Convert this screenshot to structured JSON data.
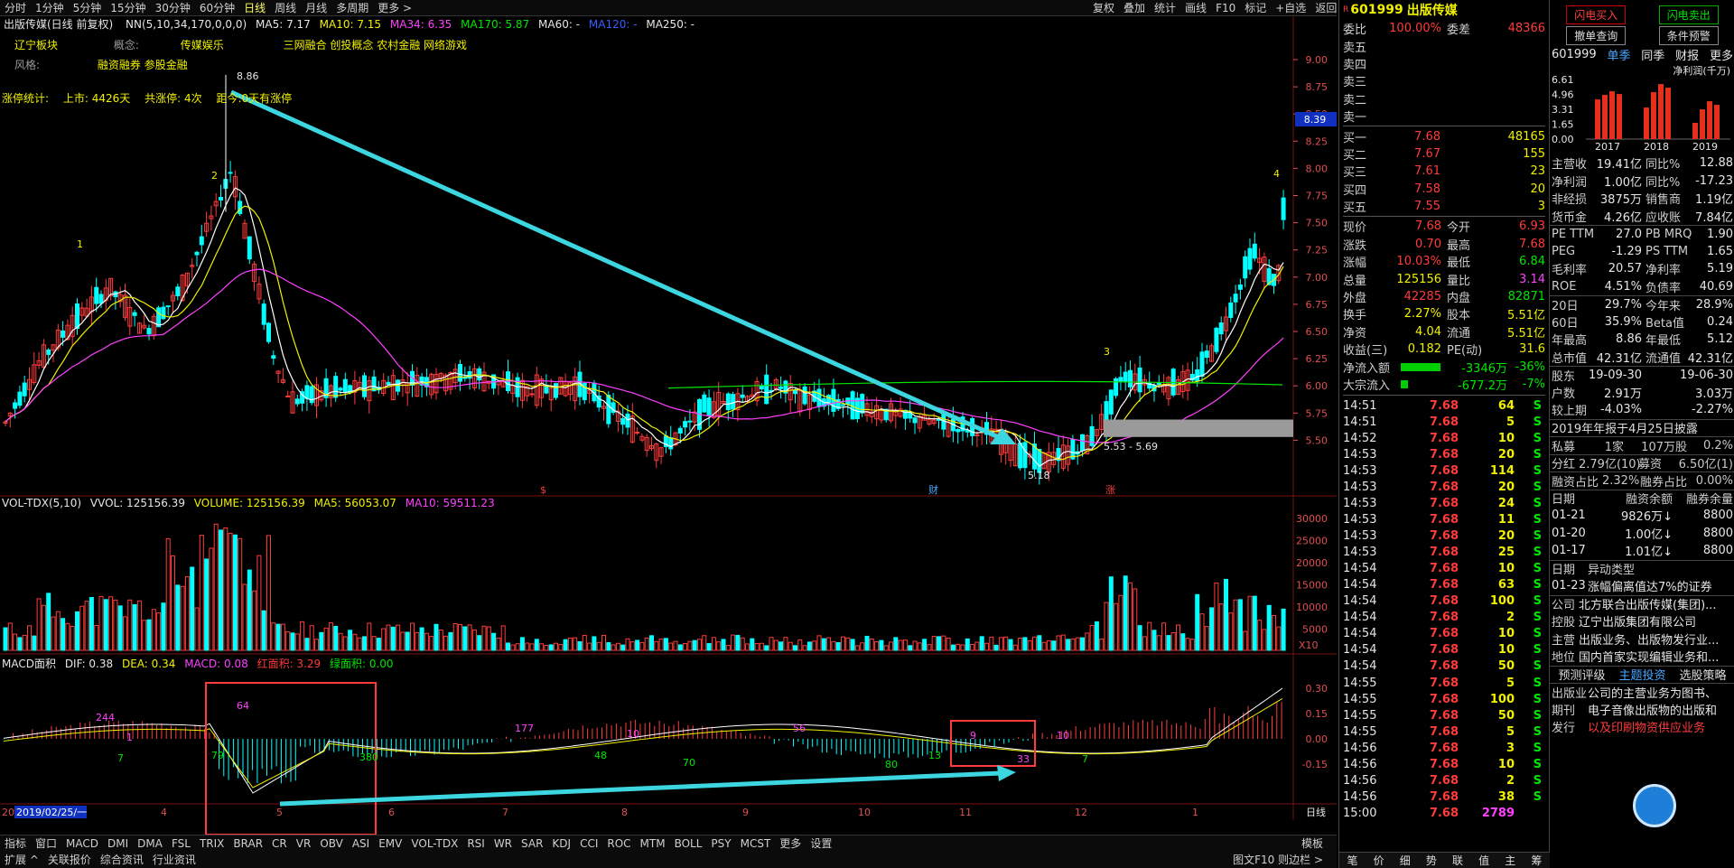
{
  "topbar": {
    "periods": [
      "分时",
      "1分钟",
      "5分钟",
      "15分钟",
      "30分钟",
      "60分钟",
      "日线",
      "周线",
      "月线",
      "多周期",
      "更多 >"
    ],
    "active": "日线",
    "right_tools": [
      "复权",
      "叠加",
      "统计",
      "画线",
      "F10",
      "标记",
      "+自选",
      "返回"
    ]
  },
  "main": {
    "title": "出版传媒(日线 前复权)",
    "ma": {
      "nn": "NN(5,10,34,170,0,0,0)",
      "ma5": "MA5: 7.17",
      "ma10": "MA10: 7.15",
      "ma34": "MA34: 6.35",
      "ma170": "MA170: 5.87",
      "ma60": "MA60: -",
      "ma120": "MA120: -",
      "ma250": "MA250: -"
    },
    "sector": {
      "label": "辽宁板块",
      "concept_label": "概念:",
      "concept_value": "传媒娱乐",
      "concepts": "三网融合 创投概念 农村金融 网络游戏"
    },
    "style": {
      "label": "风格:",
      "value": "融资融券 参股金融"
    },
    "stats": {
      "label": "涨停统计:",
      "listed": "上市: 4426天",
      "total": "共涨停: 4次",
      "since": "距今:0天有涨停"
    },
    "annotations": {
      "high": "8.86",
      "low": "5.18",
      "range": "5.53 - 5.69",
      "n1": "1",
      "n2": "2",
      "n3": "3",
      "n4": "4",
      "price_tag": "8.39"
    },
    "events": [
      "$",
      "财",
      "涨"
    ],
    "price_axis": [
      "9.00",
      "8.75",
      "8.50",
      "8.25",
      "8.00",
      "7.75",
      "7.50",
      "7.25",
      "7.00",
      "6.75",
      "6.50",
      "6.25",
      "6.00",
      "5.75",
      "5.50"
    ],
    "vol": {
      "title": "VOL-TDX(5,10)",
      "vvol": "VVOL: 125156.39",
      "volume": "VOLUME: 125156.39",
      "ma5": "MA5: 56053.07",
      "ma10": "MA10: 59511.23",
      "axis": [
        "30000",
        "25000",
        "20000",
        "15000",
        "10000",
        "5000"
      ],
      "unit": "X10"
    },
    "macd": {
      "title": "MACD面积",
      "dif": "DIF: 0.38",
      "dea": "DEA: 0.34",
      "macd": "MACD: 0.08",
      "red_area": "红面积: 3.29",
      "green_area": "绿面积: 0.00",
      "axis": [
        "0.30",
        "0.15",
        "0.00",
        "-0.15"
      ],
      "labels": [
        "244",
        "1",
        "7",
        "64",
        "79",
        "380",
        "177",
        "48",
        "10",
        "70",
        "56",
        "80",
        "13",
        "9",
        "33",
        "10",
        "7"
      ]
    },
    "time_axis": {
      "current": "2019/02/25/一",
      "months": [
        "4",
        "5",
        "6",
        "7",
        "8",
        "9",
        "10",
        "11",
        "12",
        "1"
      ],
      "label": "日线",
      "start": "20"
    }
  },
  "bottombar": {
    "row1": [
      "指标",
      "窗口",
      "MACD",
      "DMI",
      "DMA",
      "FSL",
      "TRIX",
      "BRAR",
      "CR",
      "VR",
      "OBV",
      "ASI",
      "EMV",
      "VOL-TDX",
      "RSI",
      "WR",
      "SAR",
      "KDJ",
      "CCI",
      "ROC",
      "MTM",
      "BOLL",
      "PSY",
      "MCST",
      "更多",
      "设置"
    ],
    "row1_right": "模板",
    "row2": [
      "扩展 ^",
      "关联报价",
      "综合资讯",
      "行业资讯"
    ],
    "row2_right": "图文F10 则边栏 >"
  },
  "quote": {
    "code": "601999",
    "name": "出版传媒",
    "r": "R",
    "weibi": {
      "k": "委比",
      "v": "100.00%",
      "k2": "委差",
      "v2": "48366"
    },
    "sells": [
      {
        "k": "卖五"
      },
      {
        "k": "卖四"
      },
      {
        "k": "卖三"
      },
      {
        "k": "卖二"
      },
      {
        "k": "卖一"
      }
    ],
    "buys": [
      {
        "k": "买一",
        "p": "7.68",
        "q": "48165"
      },
      {
        "k": "买二",
        "p": "7.67",
        "q": "155"
      },
      {
        "k": "买三",
        "p": "7.61",
        "q": "23"
      },
      {
        "k": "买四",
        "p": "7.58",
        "q": "20"
      },
      {
        "k": "买五",
        "p": "7.55",
        "q": "3"
      }
    ],
    "stats": [
      {
        "k": "现价",
        "v": "7.68",
        "k2": "今开",
        "v2": "6.93"
      },
      {
        "k": "涨跌",
        "v": "0.70",
        "k2": "最高",
        "v2": "7.68"
      },
      {
        "k": "涨幅",
        "v": "10.03%",
        "k2": "最低",
        "v2": "6.84"
      },
      {
        "k": "总量",
        "v": "125156",
        "k2": "量比",
        "v2": "3.14"
      },
      {
        "k": "外盘",
        "v": "42285",
        "k2": "内盘",
        "v2": "82871"
      },
      {
        "k": "换手",
        "v": "2.27%",
        "k2": "股本",
        "v2": "5.51亿"
      },
      {
        "k": "净资",
        "v": "4.04",
        "k2": "流通",
        "v2": "5.51亿"
      },
      {
        "k": "收益(三)",
        "v": "0.182",
        "k2": "PE(动)",
        "v2": "31.6"
      }
    ],
    "flow": [
      {
        "k": "净流入额",
        "v": "-3346万",
        "p": "-36%"
      },
      {
        "k": "大宗流入",
        "v": "-677.2万",
        "p": "-7%"
      }
    ],
    "trades": [
      {
        "t": "14:51",
        "p": "7.68",
        "q": "64",
        "s": "S"
      },
      {
        "t": "14:51",
        "p": "7.68",
        "q": "5",
        "s": "S"
      },
      {
        "t": "14:52",
        "p": "7.68",
        "q": "10",
        "s": "S"
      },
      {
        "t": "14:53",
        "p": "7.68",
        "q": "20",
        "s": "S"
      },
      {
        "t": "14:53",
        "p": "7.68",
        "q": "114",
        "s": "S"
      },
      {
        "t": "14:53",
        "p": "7.68",
        "q": "20",
        "s": "S"
      },
      {
        "t": "14:53",
        "p": "7.68",
        "q": "24",
        "s": "S"
      },
      {
        "t": "14:53",
        "p": "7.68",
        "q": "11",
        "s": "S"
      },
      {
        "t": "14:53",
        "p": "7.68",
        "q": "20",
        "s": "S"
      },
      {
        "t": "14:53",
        "p": "7.68",
        "q": "25",
        "s": "S"
      },
      {
        "t": "14:54",
        "p": "7.68",
        "q": "10",
        "s": "S"
      },
      {
        "t": "14:54",
        "p": "7.68",
        "q": "63",
        "s": "S"
      },
      {
        "t": "14:54",
        "p": "7.68",
        "q": "100",
        "s": "S"
      },
      {
        "t": "14:54",
        "p": "7.68",
        "q": "2",
        "s": "S"
      },
      {
        "t": "14:54",
        "p": "7.68",
        "q": "10",
        "s": "S"
      },
      {
        "t": "14:54",
        "p": "7.68",
        "q": "10",
        "s": "S"
      },
      {
        "t": "14:54",
        "p": "7.68",
        "q": "50",
        "s": "S"
      },
      {
        "t": "14:55",
        "p": "7.68",
        "q": "5",
        "s": "S"
      },
      {
        "t": "14:55",
        "p": "7.68",
        "q": "100",
        "s": "S"
      },
      {
        "t": "14:55",
        "p": "7.68",
        "q": "50",
        "s": "S"
      },
      {
        "t": "14:55",
        "p": "7.68",
        "q": "5",
        "s": "S"
      },
      {
        "t": "14:56",
        "p": "7.68",
        "q": "3",
        "s": "S"
      },
      {
        "t": "14:56",
        "p": "7.68",
        "q": "10",
        "s": "S"
      },
      {
        "t": "14:56",
        "p": "7.68",
        "q": "2",
        "s": "S"
      },
      {
        "t": "14:56",
        "p": "7.68",
        "q": "38",
        "s": "S"
      },
      {
        "t": "15:00",
        "p": "7.68",
        "q": "2789",
        "s": ""
      }
    ],
    "bottom_tabs": [
      "笔",
      "价",
      "细",
      "势",
      "联",
      "值",
      "主",
      "筹"
    ]
  },
  "fund": {
    "buttons": {
      "flash_buy": "闪电买入",
      "flash_sell": "闪电卖出",
      "cancel": "撤单查询",
      "cond": "条件预警"
    },
    "tabs": {
      "code": "601999",
      "single": "单季",
      "yoy": "同季",
      "fin": "财报",
      "more": "更多"
    },
    "profit": {
      "title": "净利润(千万)",
      "axis": [
        "6.61",
        "4.96",
        "3.31",
        "1.65",
        "0.00"
      ],
      "years": [
        "2017",
        "2018",
        "2019"
      ],
      "bars": [
        [
          4.4,
          4.9,
          5.3,
          5.0
        ],
        [
          3.5,
          5.2,
          6.1,
          5.7
        ],
        [
          1.8,
          3.3,
          4.2,
          3.8
        ]
      ]
    },
    "rows": [
      {
        "k": "主营收",
        "v": "19.41亿",
        "k2": "同比%",
        "v2": "12.88"
      },
      {
        "k": "净利润",
        "v": "1.00亿",
        "k2": "同比%",
        "v2": "-17.23"
      },
      {
        "k": "非经损",
        "v": "3875万",
        "k2": "销售商",
        "v2": "1.19亿"
      },
      {
        "k": "货币金",
        "v": "4.26亿",
        "k2": "应收账",
        "v2": "7.84亿"
      },
      {
        "k": "PE TTM",
        "v": "27.0",
        "k2": "PB MRQ",
        "v2": "1.90"
      },
      {
        "k": "PEG",
        "v": "-1.29",
        "k2": "PS TTM",
        "v2": "1.65"
      },
      {
        "k": "毛利率",
        "v": "20.57",
        "k2": "净利率",
        "v2": "5.19"
      },
      {
        "k": "ROE",
        "v": "4.51%",
        "k2": "负债率",
        "v2": "40.69"
      },
      {
        "k": "20日",
        "v": "29.7%",
        "k2": "今年来",
        "v2": "28.9%"
      },
      {
        "k": "60日",
        "v": "35.9%",
        "k2": "Beta值",
        "v2": "0.24"
      },
      {
        "k": "年最高",
        "v": "8.86",
        "k2": "年最低",
        "v2": "5.12"
      },
      {
        "k": "总市值",
        "v": "42.31亿",
        "k2": "流通值",
        "v2": "42.31亿"
      },
      {
        "k": "股东",
        "v": "19-09-30",
        "k2": "",
        "v2": "19-06-30"
      },
      {
        "k": "户数",
        "v": "2.91万",
        "k2": "",
        "v2": "3.03万"
      },
      {
        "k": "较上期",
        "v": "-4.03%",
        "k2": "",
        "v2": "-2.27%"
      }
    ],
    "report": "2019年年报于4月25日披露",
    "private": {
      "k": "私募",
      "v": "1家",
      "v2": "107万股",
      "v3": "0.2%"
    },
    "dividend": {
      "k": "分红",
      "v": "2.79亿(10)",
      "k2": "募资",
      "v2": "6.50亿(1)"
    },
    "margin": {
      "k": "融资占比",
      "v": "2.32%",
      "k2": "融券占比",
      "v2": "0.00%"
    },
    "margin_table": {
      "headers": [
        "日期",
        "融资余额",
        "融券余量"
      ],
      "rows": [
        [
          "01-21",
          "9826万↓",
          "8800"
        ],
        [
          "01-20",
          "1.00亿↓",
          "8800"
        ],
        [
          "01-17",
          "1.01亿↓",
          "8800"
        ]
      ]
    },
    "abnormal": {
      "headers": [
        "日期",
        "异动类型"
      ],
      "rows": [
        [
          "01-23",
          "涨幅偏离值达7%的证券"
        ]
      ]
    },
    "company": [
      {
        "k": "公司",
        "v": "北方联合出版传媒(集团)..."
      },
      {
        "k": "控股",
        "v": "辽宁出版集团有限公司"
      },
      {
        "k": "主营",
        "v": "出版业务、出版物发行业..."
      },
      {
        "k": "地位",
        "v": "国内首家实现编辑业务和..."
      }
    ],
    "rating_tabs": [
      "预测评级",
      "主题投资",
      "选股策略"
    ],
    "desc": {
      "k1": "出版业",
      "v1": "公司的主营业务为图书、",
      "k2": "期刊",
      "v2": "电子音像出版物的出版和",
      "k3": "发行",
      "v3": "以及印刷物资供应业务"
    }
  },
  "colors": {
    "up": "#ff3b3b",
    "down": "#00ffff",
    "ma5": "#ffffff",
    "ma10": "#f0f000",
    "ma34": "#ff40ff",
    "ma170": "#00e600",
    "arrow": "#3cd6e0",
    "box": "#ff3b3b"
  }
}
